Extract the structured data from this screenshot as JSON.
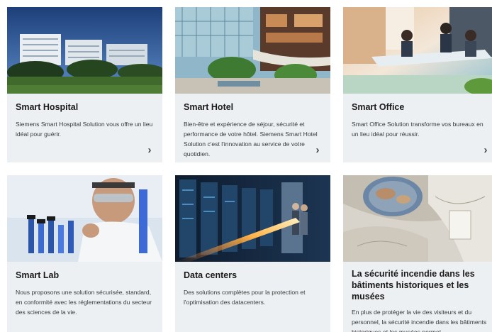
{
  "cards": [
    {
      "title": "Smart Hospital",
      "description": "Siemens Smart Hospital Solution vous offre un lieu idéal pour guérir.",
      "image_icon": "hospital-building-photo",
      "arrow_icon": "chevron-right-icon"
    },
    {
      "title": "Smart Hotel",
      "description": "Bien-être et expérience de séjour, sécurité et performance de votre hôtel. Siemens Smart Hotel Solution c'est l'innovation au service de votre quotidien.",
      "image_icon": "hotel-atrium-photo",
      "arrow_icon": "chevron-right-icon"
    },
    {
      "title": "Smart Office",
      "description": "Smart Office Solution transforme vos bureaux en un lieu idéal pour réussir.",
      "image_icon": "office-meeting-photo",
      "arrow_icon": "chevron-right-icon"
    },
    {
      "title": "Smart Lab",
      "description": "Nous proposons une solution sécurisée, standard, en conformité avec les réglementations du secteur des sciences de la vie.",
      "image_icon": "laboratory-scientist-photo"
    },
    {
      "title": "Data centers",
      "description": "Des solutions complètes pour la protection et l'optimisation des datacenters.",
      "image_icon": "datacenter-servers-photo"
    },
    {
      "title": "La sécurité incendie dans les bâtiments historiques et les musées",
      "description": "En plus de protéger la vie des visiteurs et du personnel, la sécurité incendie dans les bâtiments historiques et les musées permet",
      "image_icon": "historic-ceiling-photo"
    }
  ],
  "colors": {
    "card_background": "#ecf0f3",
    "title_text": "#1b1b1b",
    "body_text": "#3a3a3a"
  }
}
